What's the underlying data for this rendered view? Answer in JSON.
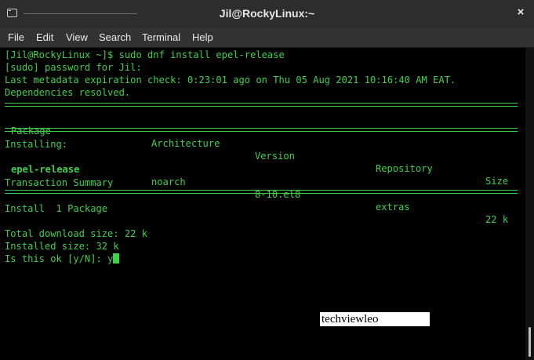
{
  "window": {
    "title": "Jil@RockyLinux:~",
    "close_glyph": "×"
  },
  "menu": {
    "items": [
      "File",
      "Edit",
      "View",
      "Search",
      "Terminal",
      "Help"
    ]
  },
  "terminal": {
    "colors": {
      "text": "#40d04a",
      "background": "#000000"
    },
    "lines": {
      "cmd": "[Jil@RockyLinux ~]$ sudo dnf install epel-release",
      "sudo": "[sudo] password for Jil:",
      "metadata": "Last metadata expiration check: 0:23:01 ago on Thu 05 Aug 2021 10:16:40 AM EAT.",
      "resolved": "Dependencies resolved.",
      "installing": "Installing:",
      "summary": "Transaction Summary",
      "install_count": "Install  1 Package",
      "download_size": "Total download size: 22 k",
      "installed_size": "Installed size: 32 k",
      "prompt": "Is this ok [y/N]: y"
    },
    "table": {
      "headers": {
        "package": "Package",
        "architecture": "Architecture",
        "version": "Version",
        "repository": "Repository",
        "size": "Size"
      },
      "row": {
        "package": "epel-release",
        "architecture": "noarch",
        "version": "8-10.el8",
        "repository": "extras",
        "size": "22 k"
      }
    }
  },
  "watermark": {
    "text": "techviewleo"
  }
}
